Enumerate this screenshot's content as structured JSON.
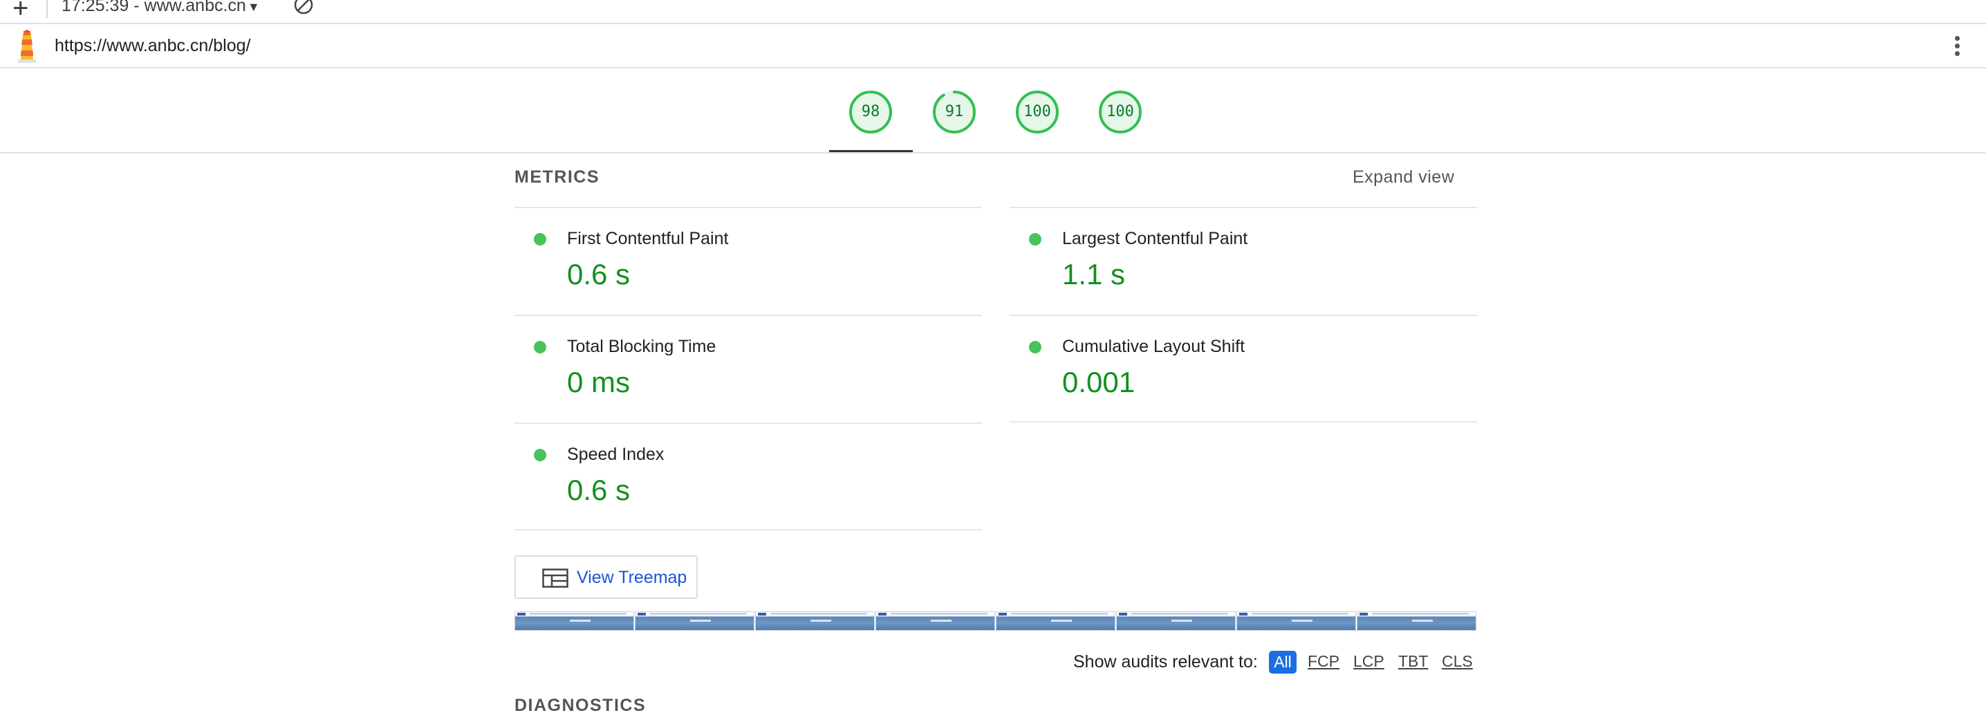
{
  "toolbar": {
    "new_report_icon": "plus-icon",
    "report_selector": "17:25:39 - www.anbc.cn",
    "clear_icon": "block-icon"
  },
  "urlbar": {
    "logo_icon": "lighthouse-icon",
    "url": "https://www.anbc.cn/blog/",
    "menu_icon": "kebab-menu-icon"
  },
  "gauges": [
    {
      "score": "98",
      "fraction": 0.98
    },
    {
      "score": "91",
      "fraction": 0.91
    },
    {
      "score": "100",
      "fraction": 1.0
    },
    {
      "score": "100",
      "fraction": 1.0
    }
  ],
  "metrics": {
    "heading": "METRICS",
    "expand_label": "Expand view",
    "items": [
      {
        "title": "First Contentful Paint",
        "value": "0.6 s"
      },
      {
        "title": "Largest Contentful Paint",
        "value": "1.1 s"
      },
      {
        "title": "Total Blocking Time",
        "value": "0 ms"
      },
      {
        "title": "Cumulative Layout Shift",
        "value": "0.001"
      },
      {
        "title": "Speed Index",
        "value": "0.6 s"
      }
    ]
  },
  "treemap": {
    "label": "View Treemap",
    "icon": "treemap-icon"
  },
  "filter": {
    "label": "Show audits relevant to:",
    "options": [
      "All",
      "FCP",
      "LCP",
      "TBT",
      "CLS"
    ]
  },
  "diagnostics": {
    "heading": "DIAGNOSTICS"
  },
  "colors": {
    "pass": "#0a7a2f",
    "pass_dot": "#46c35c",
    "accent": "#1a6fe0"
  }
}
